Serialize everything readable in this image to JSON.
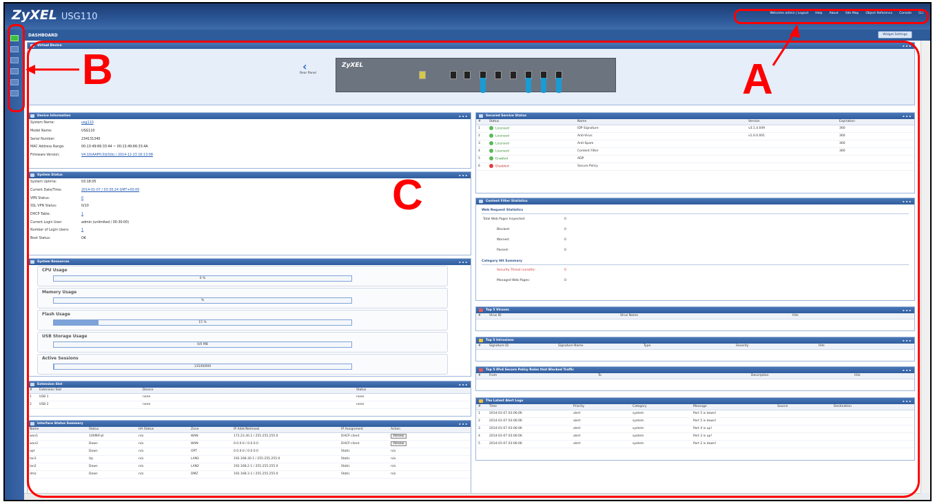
{
  "app": {
    "logo": "ZyXEL",
    "model": "USG110",
    "subtitle": "DASHBOARD",
    "widget_settings": "Widget Settings",
    "top_links": [
      "Welcome admin | Logout",
      "Help",
      "About",
      "Site Map",
      "Object Reference",
      "Console",
      "CLI"
    ]
  },
  "virtual_device": {
    "title": "Virtual Device",
    "device_logo": "ZyXEL",
    "rear_panel_label": "Rear Panel"
  },
  "device_info": {
    "title": "Device Information",
    "rows": [
      {
        "k": "System Name:",
        "v": "usg110",
        "link": true
      },
      {
        "k": "Model Name:",
        "v": "USG110",
        "link": false
      },
      {
        "k": "Serial Number:",
        "v": "234131340",
        "link": false
      },
      {
        "k": "MAC Address Range:",
        "v": "00:13:49:66:33:44 ~ 00:13:49:66:33:4A",
        "link": false
      },
      {
        "k": "Firmware Version:",
        "v": "V4.10(AAPH.0)b3(b) / 2014-12-23 16:13:08",
        "link": true
      }
    ]
  },
  "system_status": {
    "title": "System Status",
    "rows": [
      {
        "k": "System Uptime:",
        "v": "03:18:05",
        "link": false
      },
      {
        "k": "Current Date/Time:",
        "v": "2014-01-07 / 03:30:24 GMT+00:00",
        "link": true
      },
      {
        "k": "VPN Status:",
        "v": "0",
        "link": true
      },
      {
        "k": "SSL VPN Status:",
        "v": "0/10",
        "link": false
      },
      {
        "k": "DHCP Table:",
        "v": "1",
        "link": true
      },
      {
        "k": "Current Login User:",
        "v": "admin (unlimited / 00:30:00)",
        "link": false
      },
      {
        "k": "Number of Login Users:",
        "v": "1",
        "link": true
      },
      {
        "k": "Boot Status:",
        "v": "OK",
        "link": false
      }
    ]
  },
  "system_resources": {
    "title": "System Resources",
    "items": [
      {
        "label": "CPU Usage",
        "text": "0 %",
        "fraction": 0.0
      },
      {
        "label": "Memory Usage",
        "text": "%",
        "fraction": 0.0
      },
      {
        "label": "Flash Usage",
        "text": "15 %",
        "fraction": 0.15
      },
      {
        "label": "USB Storage Usage",
        "text": "0/0 MB",
        "fraction": 0.0
      },
      {
        "label": "Active Sessions",
        "text": "135/60000",
        "fraction": 0.002
      }
    ]
  },
  "extension_slot": {
    "title": "Extension Slot",
    "headers": [
      "#",
      "Extension Slot",
      "Device",
      "Status"
    ],
    "rows": [
      [
        "1",
        "USB 1",
        "none",
        "none"
      ],
      [
        "2",
        "USB 2",
        "none",
        "none"
      ]
    ]
  },
  "interface_summary": {
    "title": "Interface Status Summary",
    "headers": [
      "Name",
      "Status",
      "HA Status",
      "Zone",
      "IP Addr/Netmask",
      "IP Assignment",
      "Action"
    ],
    "rows": [
      [
        "wan1",
        "100M/Full",
        "n/a",
        "WAN",
        "172.23.30.2 / 255.255.255.0",
        "DHCP client",
        "Renew"
      ],
      [
        "wan2",
        "Down",
        "n/a",
        "WAN",
        "0.0.0.0 / 0.0.0.0",
        "DHCP client",
        "Renew"
      ],
      [
        "opt",
        "Down",
        "n/a",
        "OPT",
        "0.0.0.0 / 0.0.0.0",
        "Static",
        "n/a"
      ],
      [
        "lan1",
        "Up",
        "n/a",
        "LAN1",
        "192.168.30.1 / 255.255.255.0",
        "Static",
        "n/a"
      ],
      [
        "lan2",
        "Down",
        "n/a",
        "LAN2",
        "192.168.2.1 / 255.255.255.0",
        "Static",
        "n/a"
      ],
      [
        "dmz",
        "Down",
        "n/a",
        "DMZ",
        "192.168.3.1 / 255.255.255.0",
        "Static",
        "n/a"
      ]
    ]
  },
  "secured_service": {
    "title": "Secured Service Status",
    "headers": [
      "#",
      "Status",
      "Name",
      "Version",
      "Expiration"
    ],
    "rows": [
      [
        "1",
        "Licensed",
        "IDP Signature",
        "v3.1.4.049",
        "360"
      ],
      [
        "2",
        "Licensed",
        "Anti-Virus",
        "v1.0.0.001",
        "360"
      ],
      [
        "3",
        "Licensed",
        "Anti-Spam",
        "",
        "360"
      ],
      [
        "4",
        "Licensed",
        "Content Filter",
        "",
        "360"
      ],
      [
        "5",
        "Enabled",
        "ADP",
        "",
        ""
      ],
      [
        "6",
        "Disabled",
        "Secure Policy",
        "",
        ""
      ]
    ]
  },
  "content_filter": {
    "title": "Content Filter Statistics",
    "web_section": "Web Request Statistics",
    "web_rows": [
      {
        "k": "Total Web Pages Inspected:",
        "v": "0"
      },
      {
        "k": "Blocked:",
        "v": "0"
      },
      {
        "k": "Warned:",
        "v": "0"
      },
      {
        "k": "Passed:",
        "v": "0"
      }
    ],
    "cat_section": "Category Hit Summary",
    "cat_rows": [
      {
        "k": "Security Threat (unsafe):",
        "v": "0"
      },
      {
        "k": "Managed Web Pages:",
        "v": "0"
      }
    ]
  },
  "top_viruses": {
    "title": "Top 5 Viruses",
    "headers": [
      "#",
      "Virus ID",
      "Virus Name",
      "Hits"
    ]
  },
  "top_intrusions": {
    "title": "Top 5 Intrusions",
    "headers": [
      "#",
      "Signature ID",
      "Signature Name",
      "Type",
      "Severity",
      "Hits"
    ]
  },
  "top_ipv4": {
    "title": "Top 5 IPv4 Secure Policy Rules that Blocked Traffic",
    "headers": [
      "#",
      "From",
      "To",
      "Description",
      "Hits"
    ]
  },
  "alert_logs": {
    "title": "The Latest Alert Logs",
    "headers": [
      "#",
      "Time",
      "Priority",
      "Category",
      "Message",
      "Source",
      "Destination"
    ],
    "rows": [
      [
        "1",
        "2014-01-07 03:06:06",
        "alert",
        "system",
        "Port 5 is down!",
        "",
        ""
      ],
      [
        "2",
        "2014-01-07 03:06:06",
        "alert",
        "system",
        "Port 5 is down!",
        "",
        ""
      ],
      [
        "3",
        "2014-01-07 03:06:06",
        "alert",
        "system",
        "Port 4 is up!",
        "",
        ""
      ],
      [
        "4",
        "2014-01-07 03:06:06",
        "alert",
        "system",
        "Port 3 is up!",
        "",
        ""
      ],
      [
        "5",
        "2014-01-07 03:06:06",
        "alert",
        "system",
        "Port 2 is down!",
        "",
        ""
      ]
    ]
  },
  "annotations": {
    "a": "A",
    "b": "B",
    "c": "C",
    "color": "#ff0000"
  }
}
